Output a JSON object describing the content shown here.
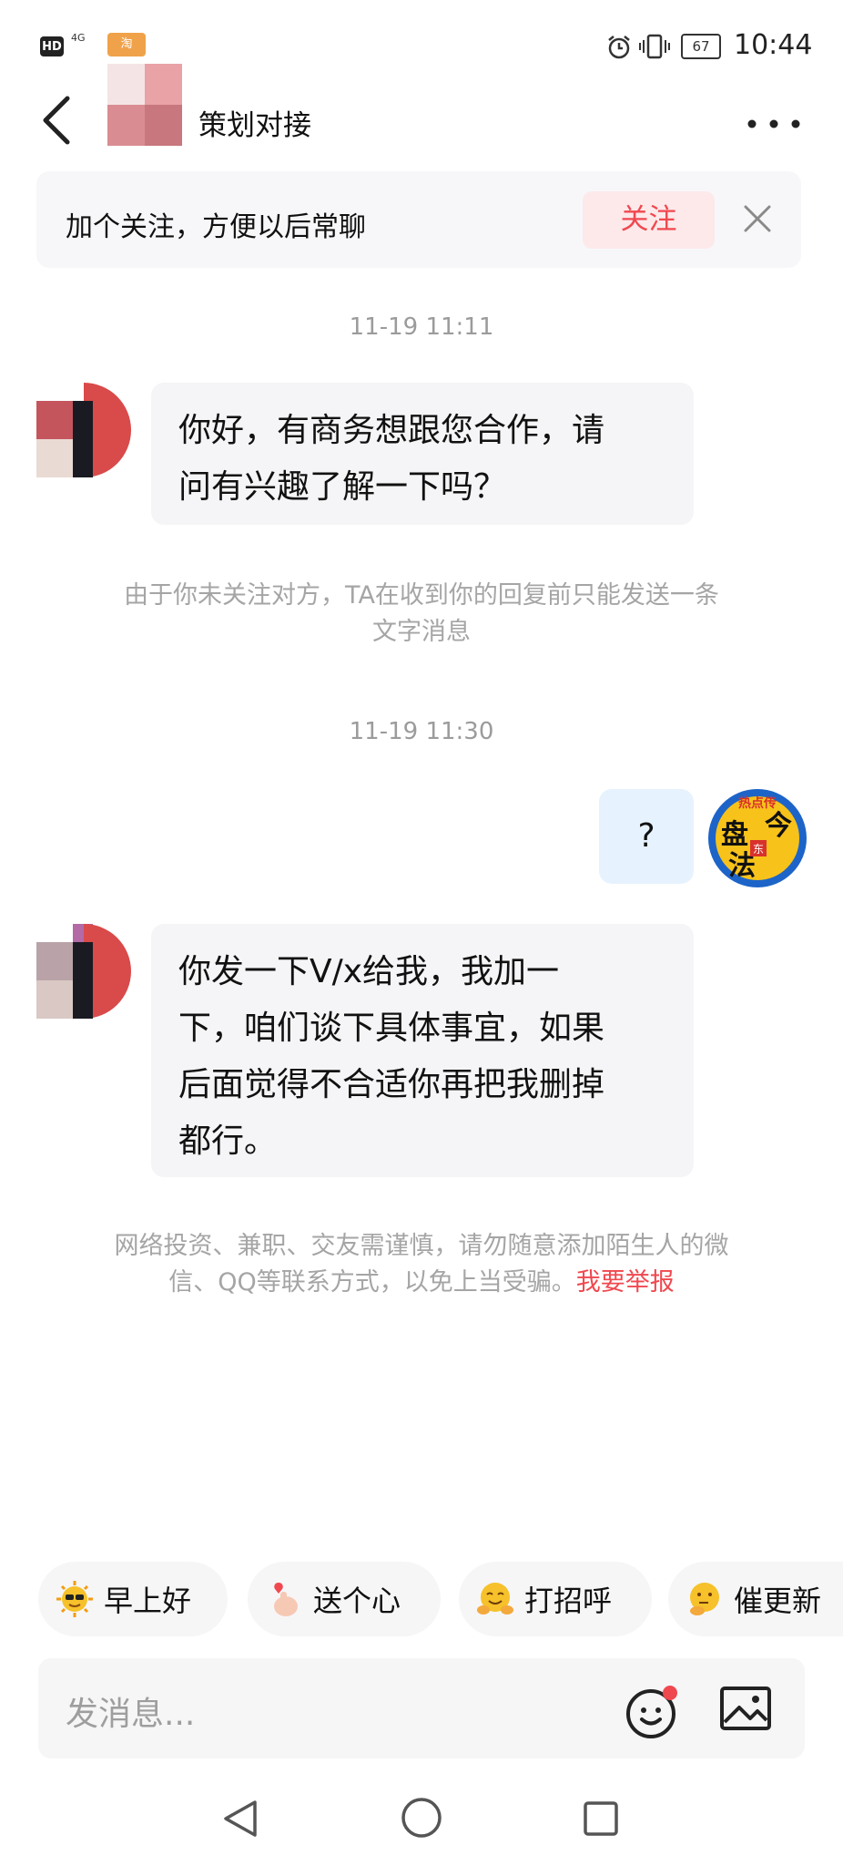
{
  "status_bar": {
    "badge": "HD",
    "network": "4G",
    "app_badge": "淘",
    "battery": "67",
    "time": "10:44"
  },
  "header": {
    "title": "策划对接"
  },
  "follow_banner": {
    "text": "加个关注，方便以后常聊",
    "button": "关注"
  },
  "messages": [
    {
      "type": "timestamp",
      "text": "11-19 11:11"
    },
    {
      "type": "incoming",
      "lines": [
        "你好，有商务想跟您合作，请",
        "问有兴趣了解一下吗？"
      ]
    },
    {
      "type": "notice",
      "lines": [
        "由于你未关注对方，TA在收到你的回复前只能发送一条",
        "文字消息"
      ]
    },
    {
      "type": "timestamp",
      "text": "11-19 11:30"
    },
    {
      "type": "outgoing",
      "text": "?"
    },
    {
      "type": "incoming",
      "lines": [
        "你发一下V/x给我，我加一",
        "下，咱们谈下具体事宜，如果",
        "后面觉得不合适你再把我删掉",
        "都行。"
      ]
    }
  ],
  "warning": {
    "line1": "网络投资、兼职、交友需谨慎，请勿随意添加陌生人的微",
    "line2": "信、QQ等联系方式，以免上当受骗。",
    "link": "我要举报"
  },
  "sender_avatar_text": {
    "top": "热点传",
    "left": "盘",
    "center": "东",
    "right": "今",
    "bottom": "法"
  },
  "quick_replies": [
    {
      "label": "早上好",
      "icon": "sun-sunglasses-emoji"
    },
    {
      "label": "送个心",
      "icon": "finger-heart-emoji"
    },
    {
      "label": "打招呼",
      "icon": "hugging-face-emoji"
    },
    {
      "label": "催更新",
      "icon": "thinking-face-emoji"
    }
  ],
  "composer": {
    "placeholder": "发消息..."
  },
  "colors": {
    "accent": "#f0484f",
    "bubble_incoming": "#f5f5f7",
    "bubble_outgoing": "#e6f2fd",
    "muted_text": "#9b9b9b"
  }
}
